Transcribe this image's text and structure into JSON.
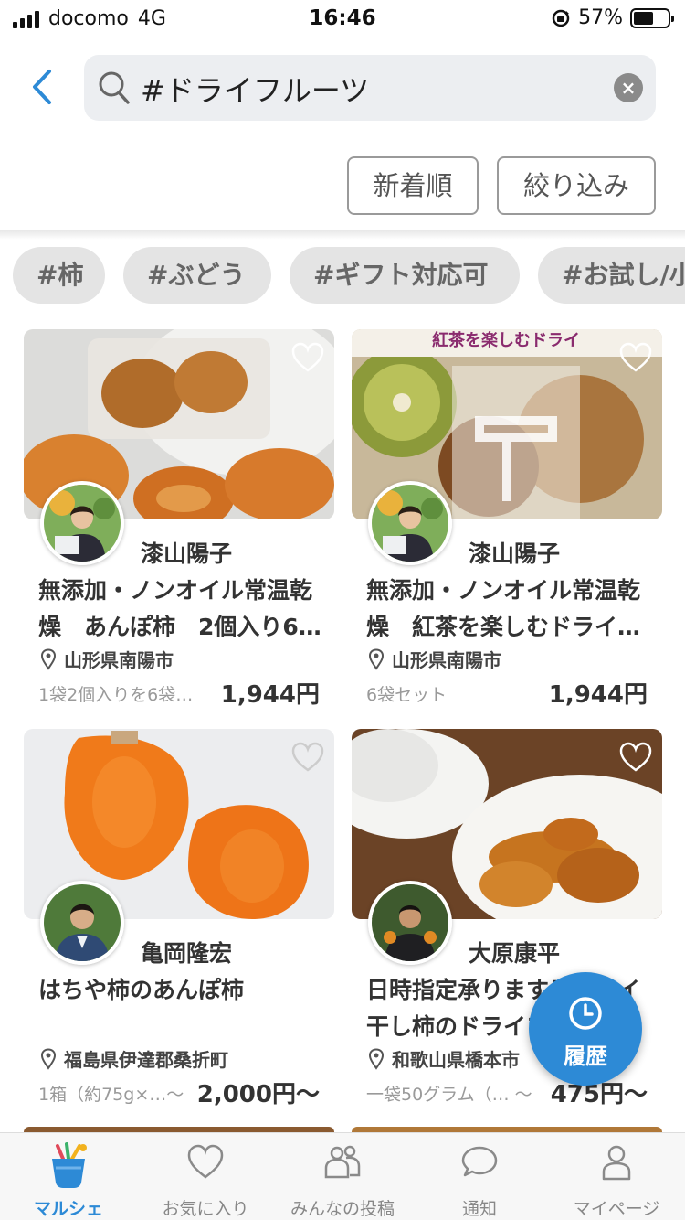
{
  "status_bar": {
    "carrier": "docomo",
    "network": "4G",
    "time": "16:46",
    "battery": "57%"
  },
  "search": {
    "query": "#ドライフルーツ"
  },
  "sort": {
    "newest_label": "新着順",
    "filter_label": "絞り込み"
  },
  "tags": [
    "#柿",
    "#ぶどう",
    "#ギフト対応可",
    "#お試し/小"
  ],
  "products": [
    {
      "seller": "漆山陽子",
      "title": "無添加・ノンオイル常温乾燥　あんぽ柿　2個入り6…",
      "location": "山形県南陽市",
      "unit": "1袋2個入りを6袋…",
      "price": "1,944円"
    },
    {
      "seller": "漆山陽子",
      "title": "無添加・ノンオイル常温乾燥　紅茶を楽しむドライ…",
      "location": "山形県南陽市",
      "unit": "6袋セット",
      "price": "1,944円"
    },
    {
      "seller": "亀岡隆宏",
      "title": "はちや柿のあんぽ柿",
      "location": "福島県伊達郡桑折町",
      "unit": "1箱（約75g×…～",
      "price": "2,000円～"
    },
    {
      "seller": "大原康平",
      "title": "日時指定承ります！ドライ干し柿のドライフル…",
      "location": "和歌山県橋本市",
      "unit": "一袋50グラム（… ～",
      "price": "475円～"
    }
  ],
  "photo_texts": {
    "p2_banner": "紅茶を楽しむドライ"
  },
  "history_button": {
    "label": "履歴"
  },
  "tab_bar": {
    "tabs": [
      {
        "label": "マルシェ"
      },
      {
        "label": "お気に入り"
      },
      {
        "label": "みんなの投稿"
      },
      {
        "label": "通知"
      },
      {
        "label": "マイページ"
      }
    ]
  },
  "colors": {
    "accent": "#2d8ad6",
    "chip_bg": "#e4e4e4",
    "search_bg": "#eceef1"
  }
}
